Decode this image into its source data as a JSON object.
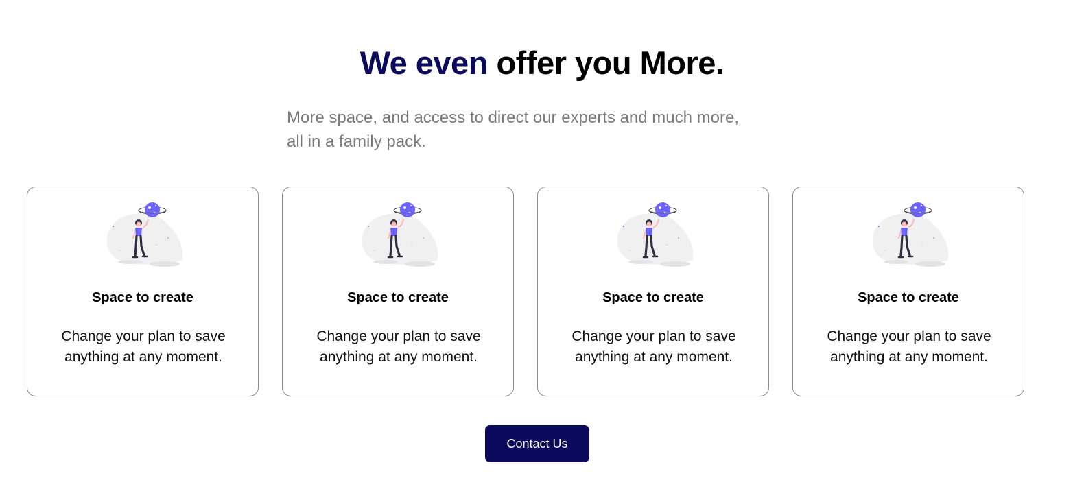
{
  "section": {
    "heading_accent": "We even",
    "heading_rest": "offer you More.",
    "subtitle_line1": "More space, and access to direct our experts and much more,",
    "subtitle_line2": "all in a family pack."
  },
  "colors": {
    "accent": "#0b0a5c",
    "illustration_purple": "#6c63ff",
    "subtitle_gray": "#7a7a7a"
  },
  "cards": [
    {
      "icon": "astronaut-planet-illustration",
      "title": "Space to create",
      "desc_line1": "Change your plan to save",
      "desc_line2": "anything at any moment."
    },
    {
      "icon": "astronaut-planet-illustration",
      "title": "Space to create",
      "desc_line1": "Change your plan to save",
      "desc_line2": "anything at any moment."
    },
    {
      "icon": "astronaut-planet-illustration",
      "title": "Space to create",
      "desc_line1": "Change your plan to save",
      "desc_line2": "anything at any moment."
    },
    {
      "icon": "astronaut-planet-illustration",
      "title": "Space to create",
      "desc_line1": "Change your plan to save",
      "desc_line2": "anything at any moment."
    }
  ],
  "contact_button": {
    "label": "Contact Us"
  }
}
